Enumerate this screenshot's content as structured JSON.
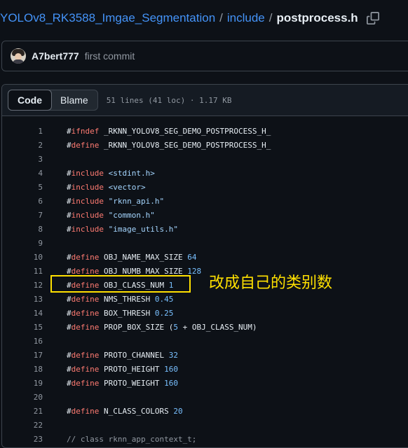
{
  "breadcrumb": {
    "repo": "YOLOv8_RK3588_Imgae_Segmentation",
    "sep1": "/",
    "folder": "include",
    "sep2": "/",
    "file": "postprocess.h",
    "copy_icon": "copy-icon"
  },
  "commit": {
    "author": "A7bert777",
    "message": "first commit"
  },
  "file_header": {
    "code_tab": "Code",
    "blame_tab": "Blame",
    "meta": "51 lines (41 loc) · 1.17 KB"
  },
  "lines": [
    {
      "n": "1",
      "parts": [
        {
          "t": "#",
          "c": ""
        },
        {
          "t": "ifndef",
          "c": "kw"
        },
        {
          "t": " _RKNN_YOLOV8_SEG_DEMO_POSTPROCESS_H_",
          "c": ""
        }
      ]
    },
    {
      "n": "2",
      "parts": [
        {
          "t": "#",
          "c": ""
        },
        {
          "t": "define",
          "c": "kw"
        },
        {
          "t": " _RKNN_YOLOV8_SEG_DEMO_POSTPROCESS_H_",
          "c": ""
        }
      ]
    },
    {
      "n": "3",
      "parts": []
    },
    {
      "n": "4",
      "parts": [
        {
          "t": "#",
          "c": ""
        },
        {
          "t": "include",
          "c": "kw"
        },
        {
          "t": " ",
          "c": ""
        },
        {
          "t": "<stdint.h>",
          "c": "str"
        }
      ]
    },
    {
      "n": "5",
      "parts": [
        {
          "t": "#",
          "c": ""
        },
        {
          "t": "include",
          "c": "kw"
        },
        {
          "t": " ",
          "c": ""
        },
        {
          "t": "<vector>",
          "c": "str"
        }
      ]
    },
    {
      "n": "6",
      "parts": [
        {
          "t": "#",
          "c": ""
        },
        {
          "t": "include",
          "c": "kw"
        },
        {
          "t": " ",
          "c": ""
        },
        {
          "t": "\"rknn_api.h\"",
          "c": "str"
        }
      ]
    },
    {
      "n": "7",
      "parts": [
        {
          "t": "#",
          "c": ""
        },
        {
          "t": "include",
          "c": "kw"
        },
        {
          "t": " ",
          "c": ""
        },
        {
          "t": "\"common.h\"",
          "c": "str"
        }
      ]
    },
    {
      "n": "8",
      "parts": [
        {
          "t": "#",
          "c": ""
        },
        {
          "t": "include",
          "c": "kw"
        },
        {
          "t": " ",
          "c": ""
        },
        {
          "t": "\"image_utils.h\"",
          "c": "str"
        }
      ]
    },
    {
      "n": "9",
      "parts": []
    },
    {
      "n": "10",
      "parts": [
        {
          "t": "#",
          "c": ""
        },
        {
          "t": "define",
          "c": "kw"
        },
        {
          "t": " OBJ_NAME_MAX_SIZE ",
          "c": ""
        },
        {
          "t": "64",
          "c": "num"
        }
      ]
    },
    {
      "n": "11",
      "parts": [
        {
          "t": "#",
          "c": ""
        },
        {
          "t": "define",
          "c": "kw"
        },
        {
          "t": " OBJ_NUMB_MAX_SIZE ",
          "c": ""
        },
        {
          "t": "128",
          "c": "num"
        }
      ]
    },
    {
      "n": "12",
      "parts": [
        {
          "t": "#",
          "c": ""
        },
        {
          "t": "define",
          "c": "kw"
        },
        {
          "t": " OBJ_CLASS_NUM ",
          "c": ""
        },
        {
          "t": "1",
          "c": "num"
        }
      ]
    },
    {
      "n": "13",
      "parts": [
        {
          "t": "#",
          "c": ""
        },
        {
          "t": "define",
          "c": "kw"
        },
        {
          "t": " NMS_THRESH ",
          "c": ""
        },
        {
          "t": "0.45",
          "c": "num"
        }
      ]
    },
    {
      "n": "14",
      "parts": [
        {
          "t": "#",
          "c": ""
        },
        {
          "t": "define",
          "c": "kw"
        },
        {
          "t": " BOX_THRESH ",
          "c": ""
        },
        {
          "t": "0.25",
          "c": "num"
        }
      ]
    },
    {
      "n": "15",
      "parts": [
        {
          "t": "#",
          "c": ""
        },
        {
          "t": "define",
          "c": "kw"
        },
        {
          "t": " PROP_BOX_SIZE (",
          "c": ""
        },
        {
          "t": "5",
          "c": "num"
        },
        {
          "t": " + OBJ_CLASS_NUM)",
          "c": ""
        }
      ]
    },
    {
      "n": "16",
      "parts": []
    },
    {
      "n": "17",
      "parts": [
        {
          "t": "#",
          "c": ""
        },
        {
          "t": "define",
          "c": "kw"
        },
        {
          "t": " PROTO_CHANNEL ",
          "c": ""
        },
        {
          "t": "32",
          "c": "num"
        }
      ]
    },
    {
      "n": "18",
      "parts": [
        {
          "t": "#",
          "c": ""
        },
        {
          "t": "define",
          "c": "kw"
        },
        {
          "t": " PROTO_HEIGHT ",
          "c": ""
        },
        {
          "t": "160",
          "c": "num"
        }
      ]
    },
    {
      "n": "19",
      "parts": [
        {
          "t": "#",
          "c": ""
        },
        {
          "t": "define",
          "c": "kw"
        },
        {
          "t": " PROTO_WEIGHT ",
          "c": ""
        },
        {
          "t": "160",
          "c": "num"
        }
      ]
    },
    {
      "n": "20",
      "parts": []
    },
    {
      "n": "21",
      "parts": [
        {
          "t": "#",
          "c": ""
        },
        {
          "t": "define",
          "c": "kw"
        },
        {
          "t": " N_CLASS_COLORS ",
          "c": ""
        },
        {
          "t": "20",
          "c": "num"
        }
      ]
    },
    {
      "n": "22",
      "parts": []
    },
    {
      "n": "23",
      "parts": [
        {
          "t": "// class rknn_app_context_t;",
          "c": "cmt"
        }
      ]
    }
  ],
  "annotation": {
    "text": "改成自己的类别数",
    "color": "#ffe000"
  }
}
